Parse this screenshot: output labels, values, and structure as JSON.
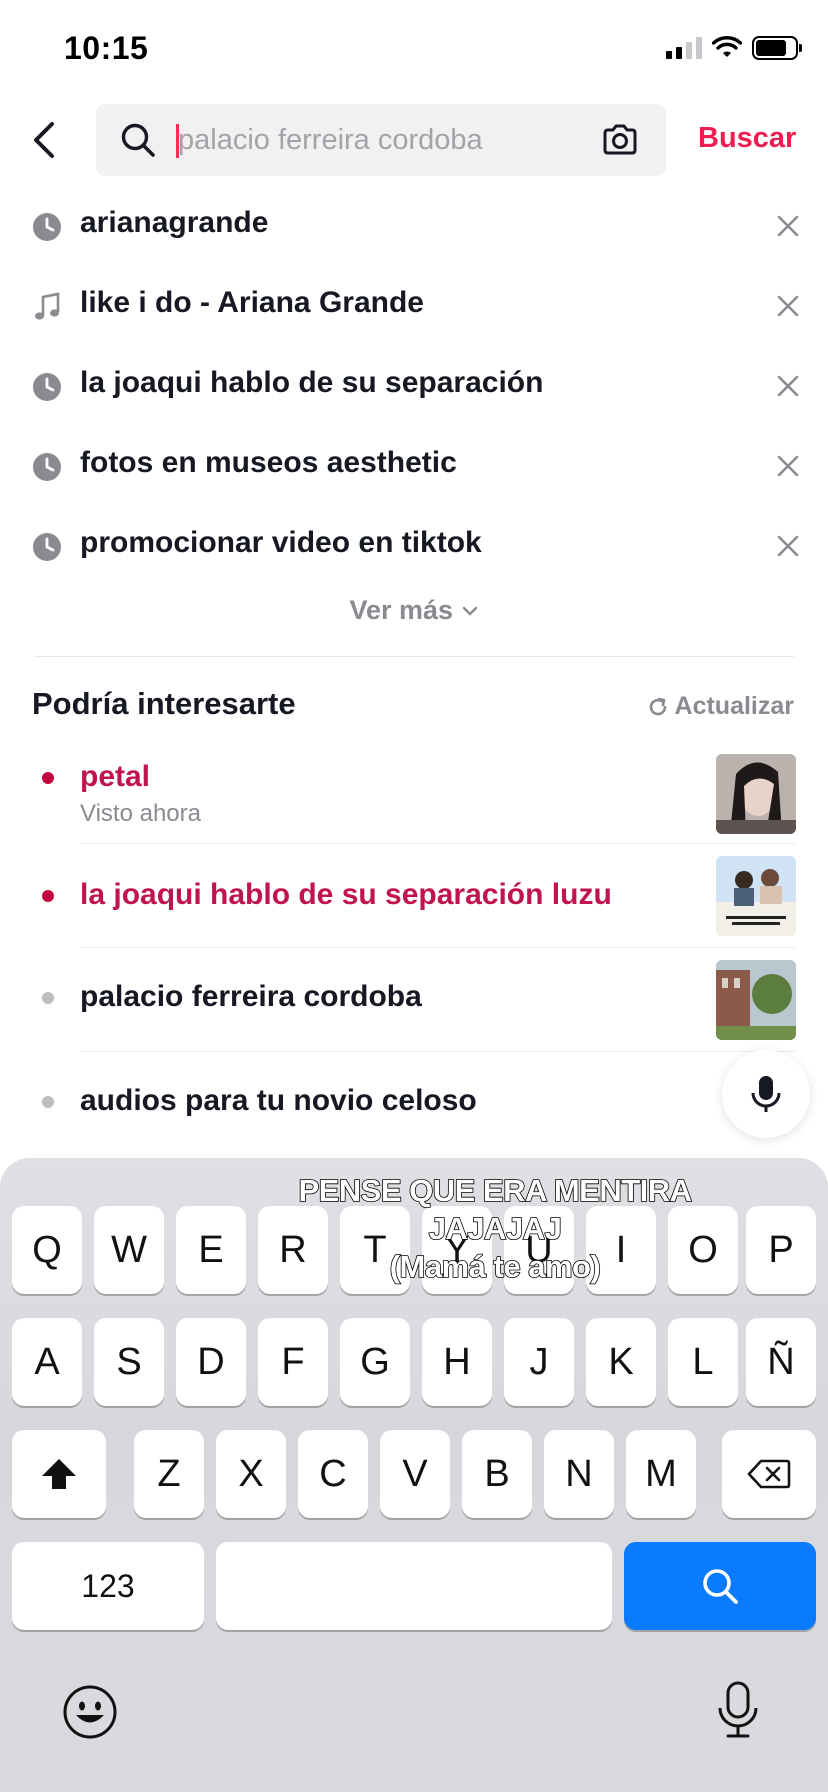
{
  "status_bar": {
    "time": "10:15"
  },
  "search": {
    "placeholder": "palacio ferreira cordoba",
    "value": "",
    "submit_label": "Buscar"
  },
  "history": [
    {
      "icon": "clock-icon",
      "label": "arianagrande"
    },
    {
      "icon": "music-note-icon",
      "label": "like i do - Ariana Grande"
    },
    {
      "icon": "clock-icon",
      "label": "la joaqui hablo de su separación"
    },
    {
      "icon": "clock-icon",
      "label": "fotos en museos aesthetic"
    },
    {
      "icon": "clock-icon",
      "label": "promocionar video en tiktok"
    }
  ],
  "see_more_label": "Ver más",
  "suggestions_section": {
    "title": "Podría interesarte",
    "refresh_label": "Actualizar",
    "items": [
      {
        "label": "petal",
        "subtitle": "Visto ahora",
        "highlighted": true,
        "has_thumbnail": true
      },
      {
        "label": "la joaqui hablo de su separación luzu",
        "highlighted": true,
        "has_thumbnail": true
      },
      {
        "label": "palacio ferreira cordoba",
        "highlighted": false,
        "has_thumbnail": true
      },
      {
        "label": "audios para tu novio celoso",
        "highlighted": false,
        "has_thumbnail": false
      }
    ]
  },
  "keyboard": {
    "row1": [
      "Q",
      "W",
      "E",
      "R",
      "T",
      "Y",
      "U",
      "I",
      "O",
      "P"
    ],
    "row2": [
      "A",
      "S",
      "D",
      "F",
      "G",
      "H",
      "J",
      "K",
      "L",
      "Ñ"
    ],
    "row3": [
      "Z",
      "X",
      "C",
      "V",
      "B",
      "N",
      "M"
    ],
    "numbers_label": "123",
    "search_key_color": "#0a7aff"
  },
  "caption_overlay": [
    "PENSE QUE ERA MENTIRA",
    "JAJAJAJ",
    "(Mamá te amo)"
  ],
  "colors": {
    "accent": "#ee1d52",
    "hot_suggestion": "#c0144b",
    "muted": "#8a8b91"
  }
}
